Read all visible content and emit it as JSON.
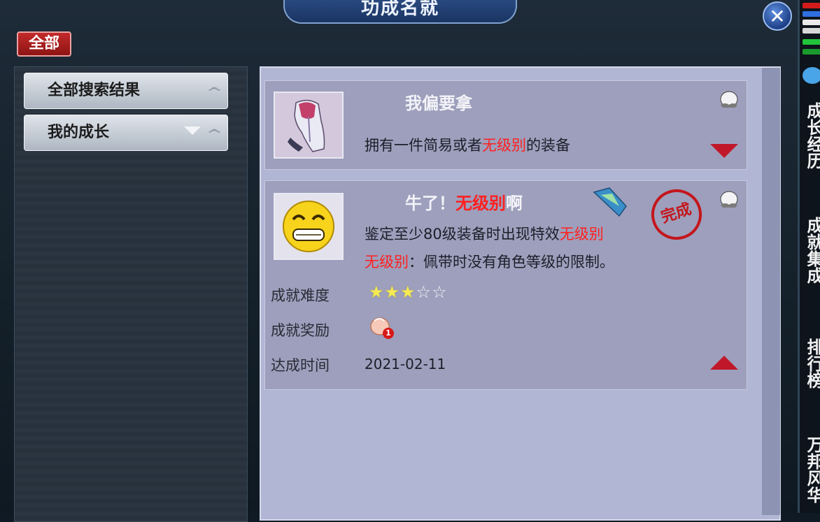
{
  "window": {
    "title": "功成名就",
    "close_glyph": "✕"
  },
  "filter": {
    "all_label": "全部"
  },
  "sidebar_nav": {
    "items": [
      {
        "label": "全部搜索结果",
        "expanded": false
      },
      {
        "label": "我的成长",
        "expanded": true
      }
    ]
  },
  "achievements": [
    {
      "title": "我偏要拿",
      "icon": "robe-armor-icon",
      "description_parts": [
        {
          "text": "拥有一件简易或者",
          "highlight": false
        },
        {
          "text": "无级别",
          "highlight": true
        },
        {
          "text": "的装备",
          "highlight": false
        }
      ],
      "collapsed": true
    },
    {
      "title_parts": [
        {
          "text": "牛了！",
          "highlight": false
        },
        {
          "text": "无级别",
          "highlight": true
        },
        {
          "text": "啊",
          "highlight": false
        }
      ],
      "icon": "grinning-face-icon",
      "description_line1_parts": [
        {
          "text": "鉴定至少80级装备时出现特效",
          "highlight": false
        },
        {
          "text": "无级别",
          "highlight": true
        }
      ],
      "description_line2_parts": [
        {
          "text": "无级别",
          "highlight": true
        },
        {
          "text": "：佩带时没有角色等级的限制。",
          "highlight": false
        }
      ],
      "stamp_text": "完成",
      "difficulty_label": "成就难度",
      "difficulty_stars": 3,
      "difficulty_max": 5,
      "reward_label": "成就奖励",
      "reward_icon": "peach-icon",
      "reward_count": "1",
      "time_label": "达成时间",
      "time_value": "2021-02-11",
      "collapsed": false
    }
  ],
  "right_tabs": [
    {
      "label": "成长经历"
    },
    {
      "label": "成就集成"
    },
    {
      "label": "排行榜"
    },
    {
      "label": "万邦风华"
    }
  ],
  "colors": {
    "highlight_red": "#ff2020",
    "panel_bg": "#b1b6d4",
    "card_bg": "#9d9fbc",
    "title_blue": "#2b4d83"
  }
}
